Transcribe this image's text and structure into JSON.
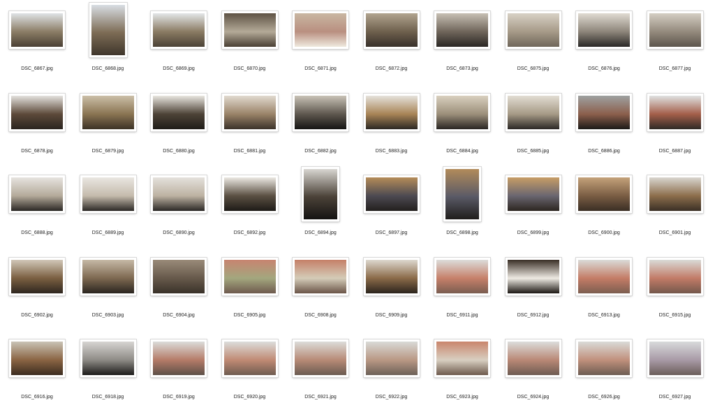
{
  "window": {
    "view": "icon-grid"
  },
  "grid": {
    "columns": 10,
    "items": [
      {
        "name": "DSC_6867.jpg",
        "orientation": "landscape",
        "colors": [
          "#dfe3e6",
          "#8b7d66",
          "#4a4034"
        ]
      },
      {
        "name": "DSC_6868.jpg",
        "orientation": "portrait",
        "colors": [
          "#d8dde3",
          "#7d6c55",
          "#3f362c"
        ]
      },
      {
        "name": "DSC_6869.jpg",
        "orientation": "landscape",
        "colors": [
          "#e3e6e8",
          "#8a7b63",
          "#4b4236"
        ]
      },
      {
        "name": "DSC_6870.jpg",
        "orientation": "landscape",
        "colors": [
          "#5e5244",
          "#b4aa98",
          "#4a4034"
        ]
      },
      {
        "name": "DSC_6871.jpg",
        "orientation": "landscape",
        "colors": [
          "#c9b7a2",
          "#b98f80",
          "#efe9de"
        ]
      },
      {
        "name": "DSC_6872.jpg",
        "orientation": "landscape",
        "colors": [
          "#b1a48f",
          "#6e604d",
          "#38302a"
        ]
      },
      {
        "name": "DSC_6873.jpg",
        "orientation": "landscape",
        "colors": [
          "#c7c0b4",
          "#6f655a",
          "#2a2724"
        ]
      },
      {
        "name": "DSC_6875.jpg",
        "orientation": "landscape",
        "colors": [
          "#d8d1c5",
          "#a69a88",
          "#6f665a"
        ]
      },
      {
        "name": "DSC_6876.jpg",
        "orientation": "landscape",
        "colors": [
          "#e0dbd2",
          "#8d857a",
          "#2a2826"
        ]
      },
      {
        "name": "DSC_6877.jpg",
        "orientation": "landscape",
        "colors": [
          "#d4cec3",
          "#948a7d",
          "#5c554c"
        ]
      },
      {
        "name": "DSC_6878.jpg",
        "orientation": "landscape",
        "colors": [
          "#e4e2de",
          "#5d4a3a",
          "#2a2420"
        ]
      },
      {
        "name": "DSC_6879.jpg",
        "orientation": "landscape",
        "colors": [
          "#cbbfa8",
          "#8a7452",
          "#3c3226"
        ]
      },
      {
        "name": "DSC_6880.jpg",
        "orientation": "landscape",
        "colors": [
          "#e9e6e0",
          "#4d4337",
          "#1f1c18"
        ]
      },
      {
        "name": "DSC_6881.jpg",
        "orientation": "landscape",
        "colors": [
          "#e1dad0",
          "#9a8368",
          "#3b322a"
        ]
      },
      {
        "name": "DSC_6882.jpg",
        "orientation": "landscape",
        "colors": [
          "#c9c3b7",
          "#5e574e",
          "#151413"
        ]
      },
      {
        "name": "DSC_6883.jpg",
        "orientation": "landscape",
        "colors": [
          "#e5e2dc",
          "#a88456",
          "#2c2823"
        ]
      },
      {
        "name": "DSC_6884.jpg",
        "orientation": "landscape",
        "colors": [
          "#d9d0bf",
          "#9c8f7a",
          "#2a2623"
        ]
      },
      {
        "name": "DSC_6885.jpg",
        "orientation": "landscape",
        "colors": [
          "#e2ddd3",
          "#a69a86",
          "#2b2825"
        ]
      },
      {
        "name": "DSC_6886.jpg",
        "orientation": "landscape",
        "colors": [
          "#9ea1a1",
          "#8c5f4c",
          "#1c1a18"
        ]
      },
      {
        "name": "DSC_6887.jpg",
        "orientation": "landscape",
        "colors": [
          "#dfe2e2",
          "#a45f4a",
          "#2f2a26"
        ]
      },
      {
        "name": "DSC_6888.jpg",
        "orientation": "landscape",
        "colors": [
          "#e6e3df",
          "#b4aa9a",
          "#2a2724"
        ]
      },
      {
        "name": "DSC_6889.jpg",
        "orientation": "landscape",
        "colors": [
          "#e9e6e1",
          "#c5bbac",
          "#2b2825"
        ]
      },
      {
        "name": "DSC_6890.jpg",
        "orientation": "landscape",
        "colors": [
          "#e4e1dc",
          "#bdb2a2",
          "#2a2725"
        ]
      },
      {
        "name": "DSC_6892.jpg",
        "orientation": "landscape",
        "colors": [
          "#ebe8e2",
          "#5b5043",
          "#1d1a17"
        ]
      },
      {
        "name": "DSC_6894.jpg",
        "orientation": "portrait",
        "colors": [
          "#d8d6d1",
          "#4b4238",
          "#141312"
        ]
      },
      {
        "name": "DSC_6897.jpg",
        "orientation": "landscape",
        "colors": [
          "#b58c58",
          "#4d4a52",
          "#221f1d"
        ]
      },
      {
        "name": "DSC_6898.jpg",
        "orientation": "portrait",
        "colors": [
          "#b28b5a",
          "#5a5a66",
          "#1f1d1b"
        ]
      },
      {
        "name": "DSC_6899.jpg",
        "orientation": "landscape",
        "colors": [
          "#c79d66",
          "#6a6670",
          "#2c2520"
        ]
      },
      {
        "name": "DSC_6900.jpg",
        "orientation": "landscape",
        "colors": [
          "#c4a27a",
          "#7a5d44",
          "#3a2e24"
        ]
      },
      {
        "name": "DSC_6901.jpg",
        "orientation": "landscape",
        "colors": [
          "#d8d5cf",
          "#8c6e4c",
          "#3a2f25"
        ]
      },
      {
        "name": "DSC_6902.jpg",
        "orientation": "landscape",
        "colors": [
          "#d1c7b8",
          "#7a5f41",
          "#2e261f"
        ]
      },
      {
        "name": "DSC_6903.jpg",
        "orientation": "landscape",
        "colors": [
          "#c6b9a6",
          "#7d6850",
          "#2a2520"
        ]
      },
      {
        "name": "DSC_6904.jpg",
        "orientation": "landscape",
        "colors": [
          "#9a8b79",
          "#66594b",
          "#3a3229"
        ]
      },
      {
        "name": "DSC_6905.jpg",
        "orientation": "landscape",
        "colors": [
          "#c78470",
          "#a3a77e",
          "#6e5a4e"
        ]
      },
      {
        "name": "DSC_6908.jpg",
        "orientation": "landscape",
        "colors": [
          "#c58068",
          "#d4ccb8",
          "#6b5548"
        ]
      },
      {
        "name": "DSC_6909.jpg",
        "orientation": "landscape",
        "colors": [
          "#ddd8cf",
          "#8a6a48",
          "#2c241d"
        ]
      },
      {
        "name": "DSC_6911.jpg",
        "orientation": "landscape",
        "colors": [
          "#dcdcda",
          "#c6806a",
          "#7a5d50"
        ]
      },
      {
        "name": "DSC_6912.jpg",
        "orientation": "landscape",
        "colors": [
          "#3a2f26",
          "#eeeae3",
          "#1c1713"
        ]
      },
      {
        "name": "DSC_6913.jpg",
        "orientation": "landscape",
        "colors": [
          "#dadbd8",
          "#c47c66",
          "#7c5e50"
        ]
      },
      {
        "name": "DSC_6915.jpg",
        "orientation": "landscape",
        "colors": [
          "#d9dad7",
          "#c27b67",
          "#74584c"
        ]
      },
      {
        "name": "DSC_6916.jpg",
        "orientation": "landscape",
        "colors": [
          "#c9c3b6",
          "#8a6443",
          "#3b2c20"
        ]
      },
      {
        "name": "DSC_6918.jpg",
        "orientation": "landscape",
        "colors": [
          "#d7d5d2",
          "#8e8b86",
          "#1c1b1a"
        ]
      },
      {
        "name": "DSC_6919.jpg",
        "orientation": "landscape",
        "colors": [
          "#dbdcda",
          "#b57b68",
          "#5d5048"
        ]
      },
      {
        "name": "DSC_6920.jpg",
        "orientation": "landscape",
        "colors": [
          "#dcdddb",
          "#c08a74",
          "#6f5c50"
        ]
      },
      {
        "name": "DSC_6921.jpg",
        "orientation": "landscape",
        "colors": [
          "#dcdcd9",
          "#b78a76",
          "#6b5b51"
        ]
      },
      {
        "name": "DSC_6922.jpg",
        "orientation": "landscape",
        "colors": [
          "#d9dad7",
          "#b99884",
          "#6d6158"
        ]
      },
      {
        "name": "DSC_6923.jpg",
        "orientation": "landscape",
        "colors": [
          "#c9856c",
          "#d8cfc1",
          "#6e5a4d"
        ]
      },
      {
        "name": "DSC_6924.jpg",
        "orientation": "landscape",
        "colors": [
          "#dcdddb",
          "#b98876",
          "#6e5c52"
        ]
      },
      {
        "name": "DSC_6926.jpg",
        "orientation": "landscape",
        "colors": [
          "#dadbd8",
          "#c0907c",
          "#6d5c52"
        ]
      },
      {
        "name": "DSC_6927.jpg",
        "orientation": "landscape",
        "colors": [
          "#d8dadb",
          "#a89aa6",
          "#6b5e5a"
        ]
      }
    ]
  }
}
